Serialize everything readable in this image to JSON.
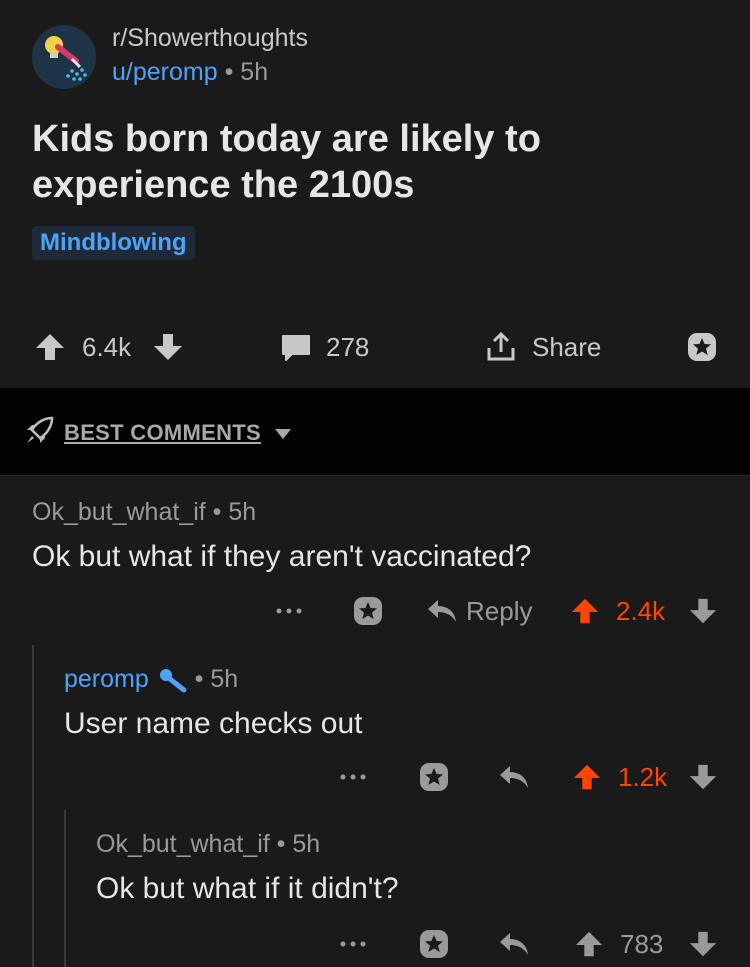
{
  "post": {
    "subreddit": "r/Showerthoughts",
    "author": "u/peromp",
    "separator": "•",
    "age": "5h",
    "title": "Kids born today are likely to experience the 2100s",
    "flair": "Mindblowing",
    "score": "6.4k",
    "comments_count": "278",
    "share_label": "Share",
    "icons": [
      "subreddit-avatar-icon",
      "upvote-icon",
      "downvote-icon",
      "comment-icon",
      "share-icon",
      "award-icon"
    ]
  },
  "sort": {
    "label": "BEST COMMENTS",
    "icons": [
      "rocket-icon",
      "caret-down-icon"
    ]
  },
  "comments": [
    {
      "author": "Ok_but_what_if",
      "age": "5h",
      "body": "Ok but what if they aren't vaccinated?",
      "reply_label": "Reply",
      "score": "2.4k",
      "upvoted": true
    },
    {
      "author": "peromp",
      "is_op": true,
      "age": "5h",
      "body": "User name checks out",
      "score": "1.2k",
      "upvoted": true
    },
    {
      "author": "Ok_but_what_if",
      "age": "5h",
      "body": "Ok but what if it didn't?",
      "score": "783",
      "upvoted": false
    }
  ],
  "colors": {
    "background": "#1a1a1b",
    "sortbar": "#030303",
    "accent_blue": "#4fa3f7",
    "upvote_orange": "#ff4500"
  }
}
